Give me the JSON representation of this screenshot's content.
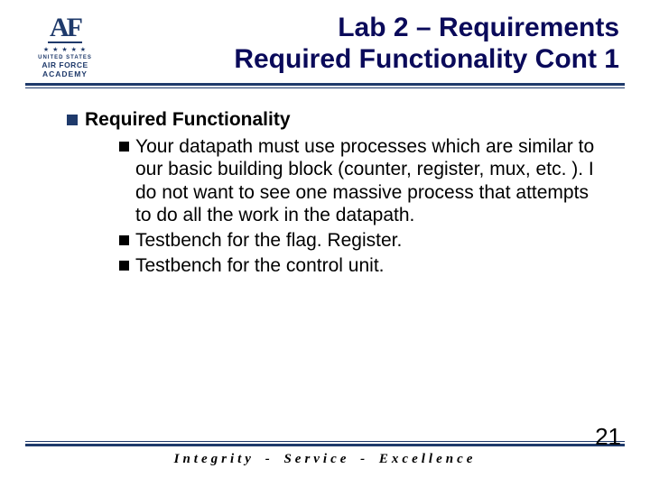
{
  "logo": {
    "monogram": "AF",
    "stars": "★ ★ ★ ★ ★",
    "line1": "UNITED STATES",
    "line2": "AIR FORCE",
    "line3": "ACADEMY"
  },
  "title": {
    "line1": "Lab 2 – Requirements",
    "line2": "Required Functionality Cont 1"
  },
  "body": {
    "heading": "Required Functionality",
    "items": [
      "Your datapath must use processes which are similar to our basic building block (counter, register, mux, etc. ). I do not want to see one massive process that attempts to do all the work in the datapath.",
      "Testbench for the flag. Register.",
      "Testbench for the control unit."
    ]
  },
  "footer": {
    "motto": "Integrity - Service - Excellence",
    "page": "21"
  }
}
